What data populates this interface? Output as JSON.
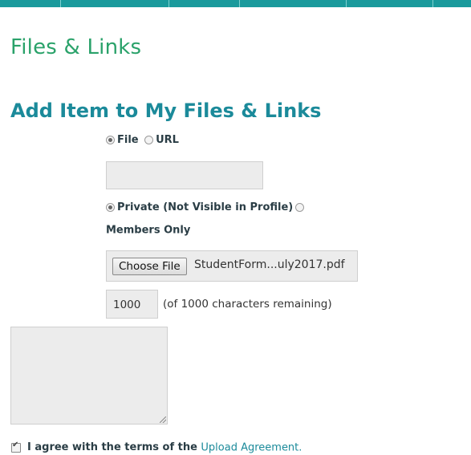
{
  "colors": {
    "topbar": "#1a9a9c",
    "page_title": "#2aa26a",
    "section_title": "#1b8a9a",
    "link": "#1b8a9a"
  },
  "page": {
    "title": "Files & Links"
  },
  "form": {
    "heading": "Add Item to My Files & Links",
    "type_options": [
      {
        "label": "File",
        "checked": true
      },
      {
        "label": "URL",
        "checked": false
      }
    ],
    "url_value": "",
    "visibility_options": [
      {
        "label": "Private (Not Visible in Profile)",
        "checked": true
      },
      {
        "label": "Members Only",
        "checked": false
      }
    ],
    "file_input": {
      "button_label": "Choose File",
      "filename": "StudentForm...uly2017.pdf"
    },
    "char_counter": {
      "remaining": "1000",
      "text": "(of 1000 characters remaining)"
    },
    "description_value": "",
    "agreement": {
      "checked": true,
      "text": "I agree with the terms of the",
      "link_text": "Upload Agreement",
      "suffix": "."
    }
  }
}
